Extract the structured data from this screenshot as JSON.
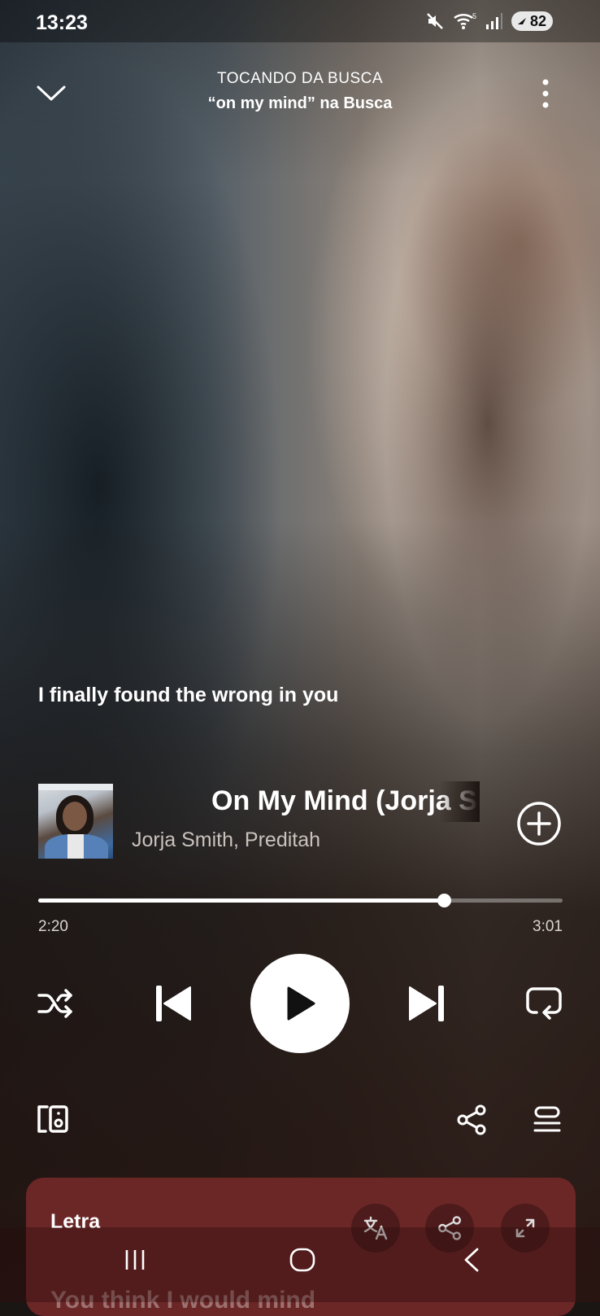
{
  "status_bar": {
    "time": "13:23",
    "battery": "82",
    "wifi_badge": "5"
  },
  "header": {
    "context_label": "TOCANDO DA BUSCA",
    "context_title": "“on my mind” na Busca"
  },
  "current_lyric": "I finally found the wrong in you",
  "track": {
    "title": "On My Mind (Jorja Smith X Preditah)",
    "artist": "Jorja Smith, Preditah"
  },
  "playback": {
    "elapsed": "2:20",
    "total": "3:01",
    "progress": 0.773
  },
  "lyrics_card": {
    "label": "Letra",
    "preview": "You think I would mind"
  },
  "colors": {
    "accent": "#ffffff",
    "lyrics_card": "#6b2626"
  },
  "icons": {
    "collapse": "chevron-down-icon",
    "more": "more-vertical-icon",
    "add": "add-circle-icon",
    "shuffle": "shuffle-icon",
    "previous": "skip-previous-icon",
    "play": "play-icon",
    "next": "skip-next-icon",
    "repeat": "repeat-icon",
    "devices": "connect-device-icon",
    "share": "share-icon",
    "queue": "queue-icon",
    "translate": "translate-icon",
    "expand": "expand-icon"
  }
}
